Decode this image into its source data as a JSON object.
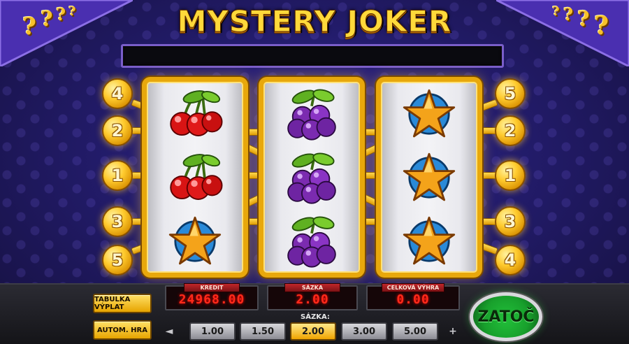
{
  "game": {
    "title": "MYSTERY JOKER",
    "message": ""
  },
  "reels": [
    [
      "cherry",
      "cherry",
      "star"
    ],
    [
      "plum",
      "plum",
      "plum"
    ],
    [
      "star",
      "star",
      "star"
    ]
  ],
  "paylines": {
    "left": [
      "4",
      "2",
      "1",
      "3",
      "5"
    ],
    "right": [
      "5",
      "2",
      "1",
      "3",
      "4"
    ]
  },
  "panel": {
    "paytable_button": "TABULKA VÝPLAT",
    "autoplay_button": "AUTOM. HRA",
    "credit_label": "KREDIT",
    "credit_value": "24968.00",
    "bet_meter_label": "SÁZKA",
    "bet_meter_value": "2.00",
    "total_win_label": "CELKOVÁ VÝHRA",
    "total_win_value": "0.00",
    "bet_selector_label": "SÁZKA:",
    "bet_options": [
      "1.00",
      "1.50",
      "2.00",
      "3.00",
      "5.00"
    ],
    "bet_selected_index": 2,
    "decrease_symbol": "◄",
    "increase_symbol": "+",
    "spin_button": "ZATOČ"
  },
  "colors": {
    "reel_frame": "#e8a80c",
    "led_red": "#ff2a1a",
    "spin_green": "#18a02c"
  }
}
